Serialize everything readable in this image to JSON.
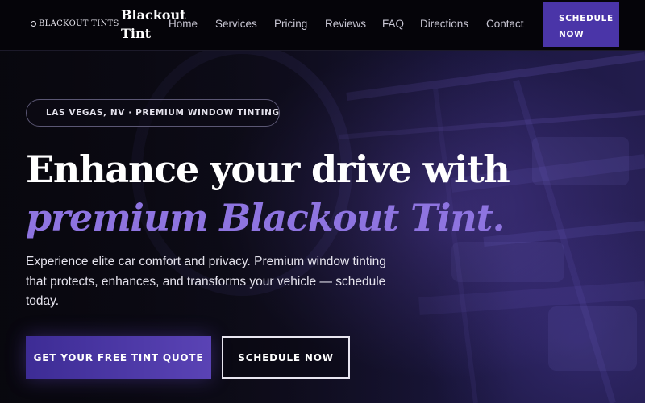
{
  "colors": {
    "accent": "#8e74e0",
    "button_primary": "#4a35a8",
    "background": "#07060c",
    "badge_dot": "#5b6fd6"
  },
  "nav": {
    "logo_text": "BLACKOUT TINTS",
    "brand_name": "Blackout Tint",
    "links": [
      "Home",
      "Services",
      "Pricing",
      "Reviews",
      "FAQ",
      "Directions",
      "Contact"
    ],
    "cta_label": "SCHEDULE NOW"
  },
  "hero": {
    "badge_text": "LAS VEGAS, NV · PREMIUM WINDOW TINTING",
    "headline_line1": "Enhance your drive with",
    "headline_line2": "premium Blackout Tint.",
    "subtext": "Experience elite car comfort and privacy. Premium window tinting that protects, enhances, and transforms your vehicle — schedule today.",
    "primary_button": "GET YOUR FREE TINT QUOTE",
    "secondary_button": "SCHEDULE NOW",
    "background_image": "car-interior-dashboard-image"
  }
}
